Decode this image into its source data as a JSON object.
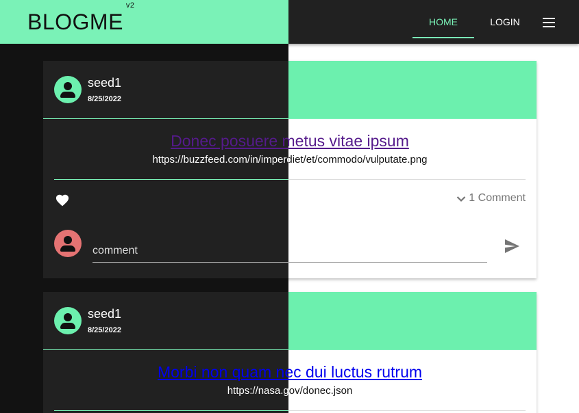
{
  "app": {
    "brand": "BLOGME",
    "version": "v2"
  },
  "nav": {
    "home_label": "HOME",
    "login_label": "LOGIN",
    "menu_icon": "hamburger-menu-icon"
  },
  "colors": {
    "accent": "#7af2b7",
    "card_header_light": "#6cf0ae",
    "dark_surface": "#212121",
    "dark_background": "#121212",
    "commenter_avatar": "#e57373",
    "visited_link": "#551a8b",
    "link": "#0000ee"
  },
  "posts": [
    {
      "author": "seed1",
      "date": "8/25/2022",
      "title": "Donec posuere metus vitae ipsum",
      "url": "https://buzzfeed.com/in/imperdiet/et/commodo/vulputate.png",
      "comments_label": "1 Comment",
      "comment_placeholder": "comment"
    },
    {
      "author": "seed1",
      "date": "8/25/2022",
      "title": "Morbi non quam nec dui luctus rutrum",
      "url": "https://nasa.gov/donec.json"
    }
  ]
}
